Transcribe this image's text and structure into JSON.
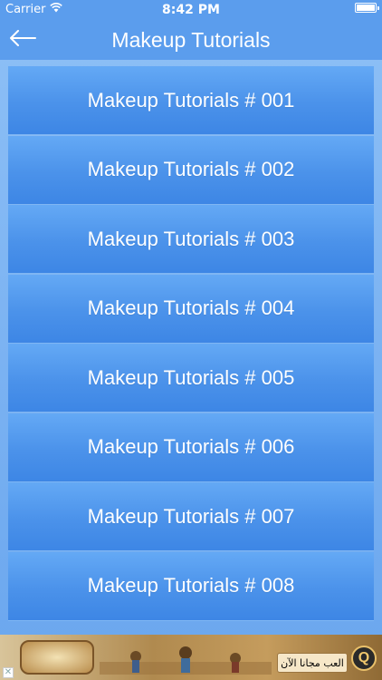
{
  "status_bar": {
    "carrier": "Carrier",
    "time": "8:42 PM"
  },
  "nav": {
    "title": "Makeup Tutorials",
    "back_icon": "arrow-left-icon"
  },
  "list": {
    "items": [
      "Makeup Tutorials # 001",
      "Makeup Tutorials # 002",
      "Makeup Tutorials # 003",
      "Makeup Tutorials # 004",
      "Makeup Tutorials # 005",
      "Makeup Tutorials # 006",
      "Makeup Tutorials # 007",
      "Makeup Tutorials # 008"
    ]
  },
  "ad": {
    "text": "العب مجانا الآن",
    "badge": "Q"
  },
  "colors": {
    "nav_background": "#5b9ded",
    "cell_top": "#64a9f5",
    "cell_bottom": "#3d86e5",
    "text": "#ffffff"
  }
}
